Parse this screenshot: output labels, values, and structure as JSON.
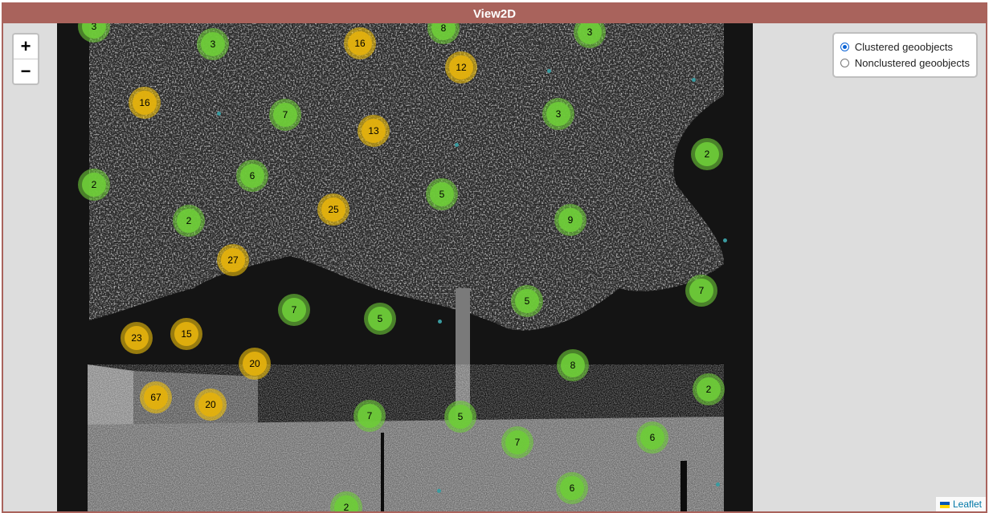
{
  "window": {
    "title": "View2D"
  },
  "zoom": {
    "in_label": "+",
    "out_label": "−"
  },
  "layer_control": {
    "options": [
      {
        "label": "Clustered geoobjects",
        "checked": true
      },
      {
        "label": "Nonclustered geoobjects",
        "checked": false
      }
    ]
  },
  "attribution": {
    "text": "Leaflet"
  },
  "colors": {
    "titlebar": "#a9635c",
    "cluster_small": "#6ecc39",
    "cluster_medium": "#e2b00e",
    "point": "#3a9ba0"
  },
  "clusters": [
    {
      "count": "3",
      "kind": "small"
    },
    {
      "count": "3",
      "kind": "small"
    },
    {
      "count": "16",
      "kind": "medium"
    },
    {
      "count": "8",
      "kind": "small"
    },
    {
      "count": "3",
      "kind": "small"
    },
    {
      "count": "12",
      "kind": "medium"
    },
    {
      "count": "16",
      "kind": "medium"
    },
    {
      "count": "7",
      "kind": "small"
    },
    {
      "count": "13",
      "kind": "medium"
    },
    {
      "count": "3",
      "kind": "small"
    },
    {
      "count": "2",
      "kind": "small"
    },
    {
      "count": "2",
      "kind": "small"
    },
    {
      "count": "6",
      "kind": "small"
    },
    {
      "count": "5",
      "kind": "small"
    },
    {
      "count": "25",
      "kind": "medium"
    },
    {
      "count": "9",
      "kind": "small"
    },
    {
      "count": "2",
      "kind": "small"
    },
    {
      "count": "27",
      "kind": "medium"
    },
    {
      "count": "7",
      "kind": "small"
    },
    {
      "count": "7",
      "kind": "small"
    },
    {
      "count": "5",
      "kind": "small"
    },
    {
      "count": "5",
      "kind": "small"
    },
    {
      "count": "23",
      "kind": "medium"
    },
    {
      "count": "15",
      "kind": "medium"
    },
    {
      "count": "20",
      "kind": "medium"
    },
    {
      "count": "8",
      "kind": "small"
    },
    {
      "count": "2",
      "kind": "small"
    },
    {
      "count": "67",
      "kind": "medium"
    },
    {
      "count": "20",
      "kind": "medium"
    },
    {
      "count": "7",
      "kind": "small"
    },
    {
      "count": "5",
      "kind": "small"
    },
    {
      "count": "7",
      "kind": "small"
    },
    {
      "count": "6",
      "kind": "small"
    },
    {
      "count": "6",
      "kind": "small"
    },
    {
      "count": "2",
      "kind": "small"
    }
  ]
}
